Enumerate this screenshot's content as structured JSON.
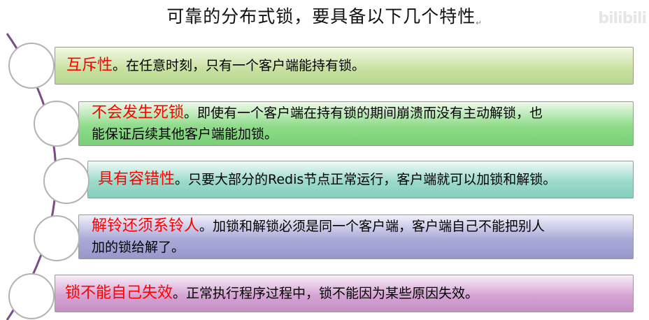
{
  "title": "可靠的分布式锁，要具备以下几个特性",
  "title_mark": "↵",
  "watermark": "bilibili",
  "colors": {
    "keyword": "#ff0000",
    "arc": "#7a4d8a",
    "circle_border": "#b3b3b3"
  },
  "items": [
    {
      "keyword": "互斥性",
      "lines": [
        "。在任意时刻，只有一个客户端能持有锁。"
      ]
    },
    {
      "keyword": "不会发生死锁",
      "lines": [
        "。即使有一个客户端在持有锁的期间崩溃而没有主动解锁，也",
        "能保证后续其他客户端能加锁。"
      ]
    },
    {
      "keyword": "具有容错性",
      "lines": [
        "。只要大部分的Redis节点正常运行，客户端就可以加锁和解锁。"
      ]
    },
    {
      "keyword": "解铃还须系铃人",
      "lines": [
        "。加锁和解锁必须是同一个客户端，客户端自己不能把别人",
        "加的锁给解了。"
      ]
    },
    {
      "keyword": "锁不能自己失效",
      "lines": [
        "。正常执行程序过程中，锁不能因为某些原因失效。"
      ]
    }
  ]
}
